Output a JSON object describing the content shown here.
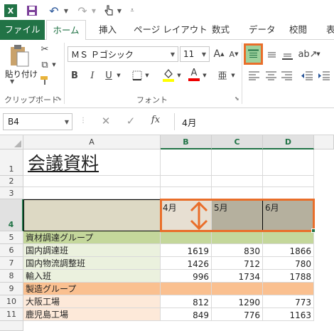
{
  "quick_access": {
    "app_icon": "excel-icon",
    "save_icon": "save-icon",
    "undo_icon": "undo-icon",
    "redo_icon": "redo-icon",
    "touch_icon": "touch-mode-icon"
  },
  "tabs": [
    "ファイル",
    "ホーム",
    "挿入",
    "ページ レイアウト",
    "数式",
    "データ",
    "校閲",
    "表"
  ],
  "ribbon": {
    "paste_label": "貼り付け",
    "clipboard_label": "クリップボード",
    "font_name": "ＭＳ Ｐゴシック",
    "font_size": "11",
    "font_label": "フォント",
    "bold": "B",
    "italic": "I",
    "underline": "U",
    "grow_font": "A",
    "shrink_font": "A",
    "font_color_letter": "A",
    "phonetic": "亜",
    "accent_color": "#217346",
    "highlight_color": "#e96e2a"
  },
  "formula_bar": {
    "name_box": "B4",
    "fx": "fx",
    "value": "4月"
  },
  "columns": [
    "A",
    "B",
    "C",
    "D"
  ],
  "rows": [
    "1",
    "2",
    "3",
    "4",
    "5",
    "6",
    "7",
    "8",
    "9",
    "10",
    "11"
  ],
  "sheet": {
    "title": "会議資料",
    "row4": [
      "",
      "4月",
      "5月",
      "6月"
    ],
    "row5": [
      "資材調達グループ",
      "",
      "",
      ""
    ],
    "row6": [
      "国内調達班",
      "1619",
      "830",
      "1866"
    ],
    "row7": [
      "国内物流調整班",
      "1426",
      "712",
      "780"
    ],
    "row8": [
      "輸入班",
      "996",
      "1734",
      "1788"
    ],
    "row9": [
      "製造グループ",
      "",
      "",
      ""
    ],
    "row10": [
      "大阪工場",
      "812",
      "1290",
      "773"
    ],
    "row11": [
      "鹿児島工場",
      "849",
      "776",
      "1163"
    ]
  },
  "colors": {
    "header_fill": "#ddd9c4",
    "gray_fill": "#b5b09e",
    "group1_fill": "#c4d79b",
    "group1_light": "#ebf1de",
    "group2_fill": "#fac090",
    "group2_light": "#fde9d9"
  }
}
